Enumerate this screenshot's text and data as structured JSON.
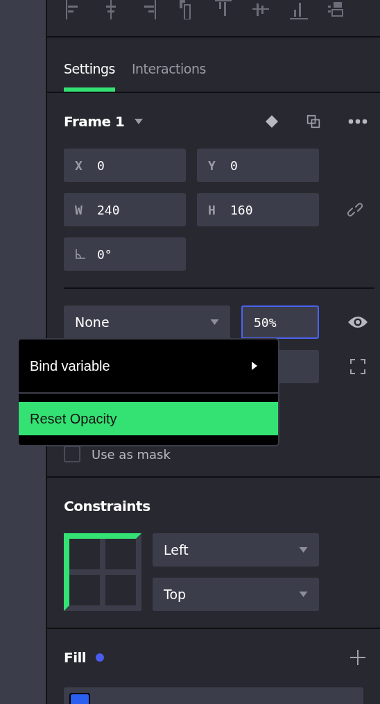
{
  "tabs": [
    {
      "label": "Settings",
      "selected": true
    },
    {
      "label": "Interactions",
      "selected": false
    }
  ],
  "frame": {
    "name": "Frame 1",
    "fields": [
      {
        "kind": "letter",
        "label": "X",
        "value": "0"
      },
      {
        "kind": "letter",
        "label": "Y",
        "value": "0"
      },
      {
        "kind": "letter",
        "label": "W",
        "value": "240"
      },
      {
        "kind": "letter",
        "label": "H",
        "value": "160"
      },
      {
        "kind": "rotation",
        "value": "0°"
      }
    ]
  },
  "layer": {
    "blend": "None",
    "opacity": "50%",
    "opacity_focused": true,
    "mask": {
      "label": "Use as mask",
      "checked": false
    }
  },
  "menu": {
    "items": [
      {
        "label": "Bind variable",
        "submenu": true,
        "selected": false
      },
      {
        "label": "Reset Opacity",
        "submenu": false,
        "selected": true
      }
    ]
  },
  "constraints": {
    "title": "Constraints",
    "horizontal": "Left",
    "vertical": "Top"
  },
  "fill": {
    "title": "Fill",
    "color": "#4a5cf0",
    "items": [
      {
        "color": "#2b5ff0"
      }
    ]
  }
}
